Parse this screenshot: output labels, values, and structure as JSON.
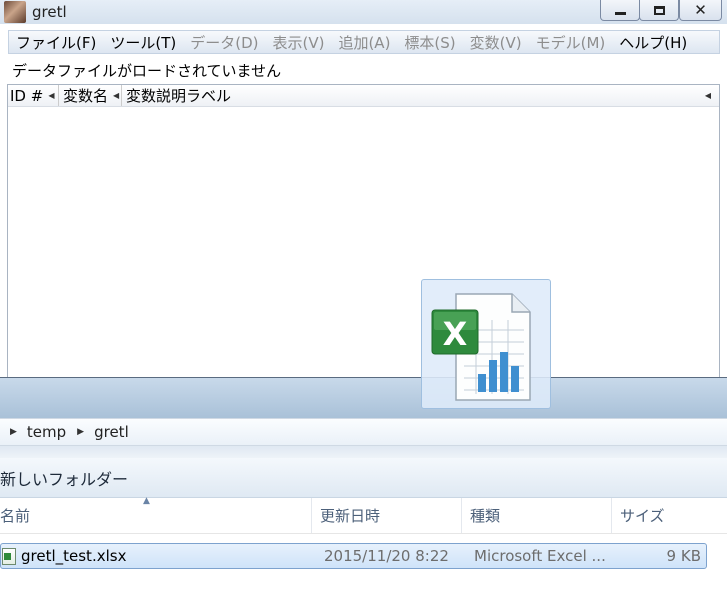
{
  "gretl": {
    "title": "gretl",
    "menu": [
      {
        "label": "ファイル(F)",
        "enabled": true
      },
      {
        "label": "ツール(T)",
        "enabled": true
      },
      {
        "label": "データ(D)",
        "enabled": false
      },
      {
        "label": "表示(V)",
        "enabled": false
      },
      {
        "label": "追加(A)",
        "enabled": false
      },
      {
        "label": "標本(S)",
        "enabled": false
      },
      {
        "label": "変数(V)",
        "enabled": false
      },
      {
        "label": "モデル(M)",
        "enabled": false
      },
      {
        "label": "ヘルプ(H)",
        "enabled": true
      }
    ],
    "status": "データファイルがロードされていません",
    "columns": {
      "id": "ID #",
      "name": "変数名",
      "label": "変数説明ラベル"
    }
  },
  "explorer": {
    "breadcrumb": [
      "temp",
      "gretl"
    ],
    "new_folder": "新しいフォルダー",
    "columns": {
      "name": "名前",
      "date": "更新日時",
      "type": "種類",
      "size": "サイズ"
    },
    "files": [
      {
        "name": "gretl_test.xlsx",
        "date": "2015/11/20 8:22",
        "type": "Microsoft Excel ...",
        "size": "9 KB",
        "icon": "excel-file-icon"
      }
    ]
  },
  "drag_icon": "excel-file-icon"
}
